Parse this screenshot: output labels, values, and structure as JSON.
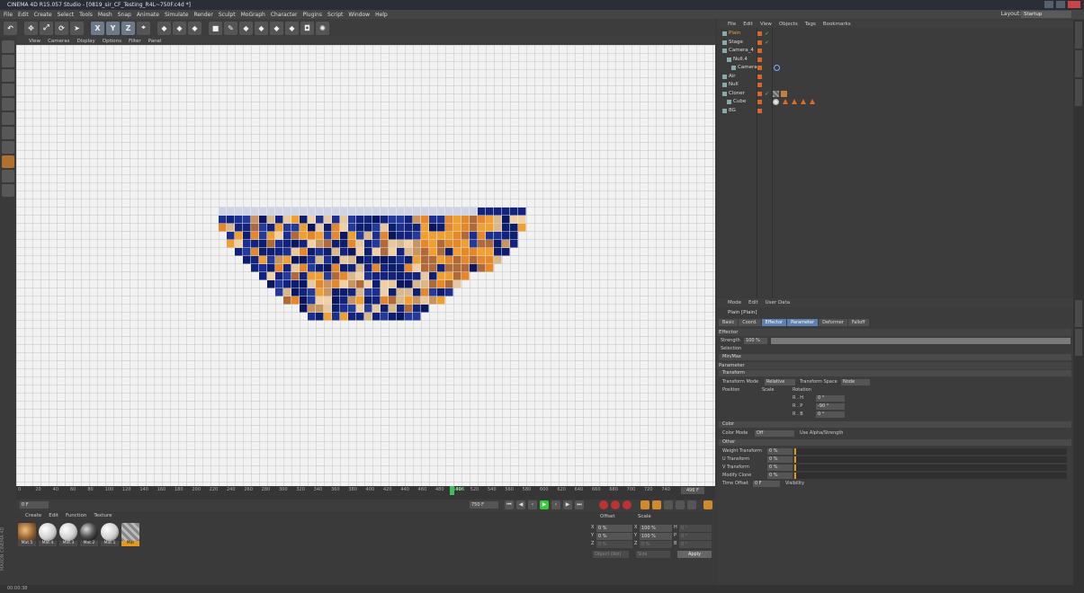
{
  "window": {
    "title": "CINEMA 4D R15.057 Studio - [0819_sir_CF_Testing_R4L~750F.c4d *]"
  },
  "menubar": {
    "items": [
      "File",
      "Edit",
      "Create",
      "Select",
      "Tools",
      "Mesh",
      "Snap",
      "Animate",
      "Simulate",
      "Render",
      "Sculpt",
      "MoGraph",
      "Character",
      "Plugins",
      "Script",
      "Window",
      "Help"
    ],
    "layout_label": "Layout:",
    "layout_value": "Startup"
  },
  "toolbar": {
    "buttons": [
      "undo-icon",
      "move-icon",
      "scale-icon",
      "rotate-icon",
      "cursor-icon",
      "x-axis-icon",
      "y-axis-icon",
      "z-axis-icon",
      "coord-system-icon",
      "render-view-icon",
      "render-picture-viewer-icon",
      "edit-render-settings-icon",
      "cube-icon",
      "pen-icon",
      "subdivision-icon",
      "array-icon",
      "deformer-icon",
      "floor-icon",
      "camera-icon",
      "light-icon"
    ],
    "axis_labels": [
      "X",
      "Y",
      "Z"
    ]
  },
  "viewport": {
    "menu": [
      "View",
      "Cameras",
      "Display",
      "Options",
      "Filter",
      "Panel"
    ]
  },
  "timeline": {
    "ticks": [
      "0",
      "20",
      "40",
      "60",
      "80",
      "100",
      "120",
      "140",
      "160",
      "180",
      "200",
      "220",
      "240",
      "260",
      "280",
      "300",
      "320",
      "340",
      "360",
      "380",
      "400",
      "420",
      "440",
      "460",
      "480",
      "500",
      "520",
      "540",
      "560",
      "580",
      "600",
      "620",
      "640",
      "660",
      "680",
      "700",
      "720",
      "740"
    ],
    "current_frame": 496,
    "current_label": "496",
    "end_frame_readout": "496 F"
  },
  "transport": {
    "start_field": "0 F",
    "end_field": "750 F"
  },
  "materials": {
    "menu": [
      "Create",
      "Edit",
      "Function",
      "Texture"
    ],
    "items": [
      {
        "name": "Mat.5",
        "style": "photo"
      },
      {
        "name": "Mat.4",
        "style": "white"
      },
      {
        "name": "Mat.3",
        "style": "white"
      },
      {
        "name": "Mat.2",
        "style": "dark"
      },
      {
        "name": "Mat.1",
        "style": "white"
      },
      {
        "name": "Mat",
        "style": "stripe",
        "selected": true
      }
    ],
    "brand": "MAXON CINEMA 4D"
  },
  "coordinates": {
    "headers": [
      "Position",
      "Size",
      "Rotation"
    ],
    "position_label": "Offset",
    "size_label": "Scale",
    "rows": [
      {
        "axis": "X",
        "a": "0 %",
        "b_axis": "X",
        "b": "100 %",
        "c_axis": "H",
        "c": "0 °"
      },
      {
        "axis": "Y",
        "a": "0 %",
        "b_axis": "Y",
        "b": "100 %",
        "c_axis": "P",
        "c": "0 °"
      },
      {
        "axis": "Z",
        "a": "0 %",
        "b_axis": "Z",
        "b": "0 %",
        "c_axis": "B",
        "c": "0 °"
      }
    ],
    "mode_select": "Object (Rel)",
    "size_select": "Size",
    "apply": "Apply"
  },
  "status": {
    "text": "00:00:38"
  },
  "object_manager": {
    "menu": [
      "File",
      "Edit",
      "View",
      "Objects",
      "Tags",
      "Bookmarks"
    ],
    "objects": [
      {
        "name": "Plain",
        "indent": 0,
        "selected": true,
        "check": true
      },
      {
        "name": "Stage",
        "indent": 0,
        "check": true
      },
      {
        "name": "Camera_4",
        "indent": 0
      },
      {
        "name": "Null.4",
        "indent": 1
      },
      {
        "name": "Camera",
        "indent": 2
      },
      {
        "name": "Air",
        "indent": 0
      },
      {
        "name": "Null",
        "indent": 0
      },
      {
        "name": "Cloner",
        "indent": 0,
        "check": true
      },
      {
        "name": "Cube",
        "indent": 1
      },
      {
        "name": "BG",
        "indent": 0
      }
    ]
  },
  "attribute_manager": {
    "menu": [
      "Mode",
      "Edit",
      "User Data"
    ],
    "title": "Plain [Plain]",
    "tabs": [
      {
        "label": "Basic"
      },
      {
        "label": "Coord."
      },
      {
        "label": "Effector",
        "active": true
      },
      {
        "label": "Parameter",
        "active": true
      },
      {
        "label": "Deformer"
      },
      {
        "label": "Falloff"
      }
    ],
    "effector_section": "Effector",
    "strength_label": "Strength",
    "strength_value": "100 %",
    "strength_fraction": 1.0,
    "selection_label": "Selection",
    "minmax_label": "Min/Max",
    "parameter_section": "Parameter",
    "transform_sub": "Transform",
    "transform_mode_label": "Transform Mode",
    "transform_mode_value": "Relative",
    "transform_space_label": "Transform Space",
    "transform_space_value": "Node",
    "position_label": "Position",
    "scale_label": "Scale",
    "rotation_label": "Rotation",
    "rot_h_label": "R . H",
    "rot_h": "0 °",
    "rot_p_label": "R . P",
    "rot_p": "-90 °",
    "rot_b_label": "R . B",
    "rot_b": "0 °",
    "color_sub": "Color",
    "color_mode_label": "Color Mode",
    "color_mode_value": "Off",
    "use_alpha_label": "Use Alpha/Strength",
    "other_sub": "Other",
    "weight_label": "Weight Transform",
    "weight_value": "0 %",
    "u_label": "U Transform",
    "u_value": "0 %",
    "v_label": "V Transform",
    "v_value": "0 %",
    "modify_label": "Modify Clone",
    "modify_value": "0 %",
    "time_label": "Time Offset",
    "time_value": "0 F",
    "visibility_label": "Visibility"
  },
  "colors": {
    "accent": "#e09a22",
    "active_tab": "#5d82b0",
    "frame_cursor": "#3fbf5a"
  }
}
